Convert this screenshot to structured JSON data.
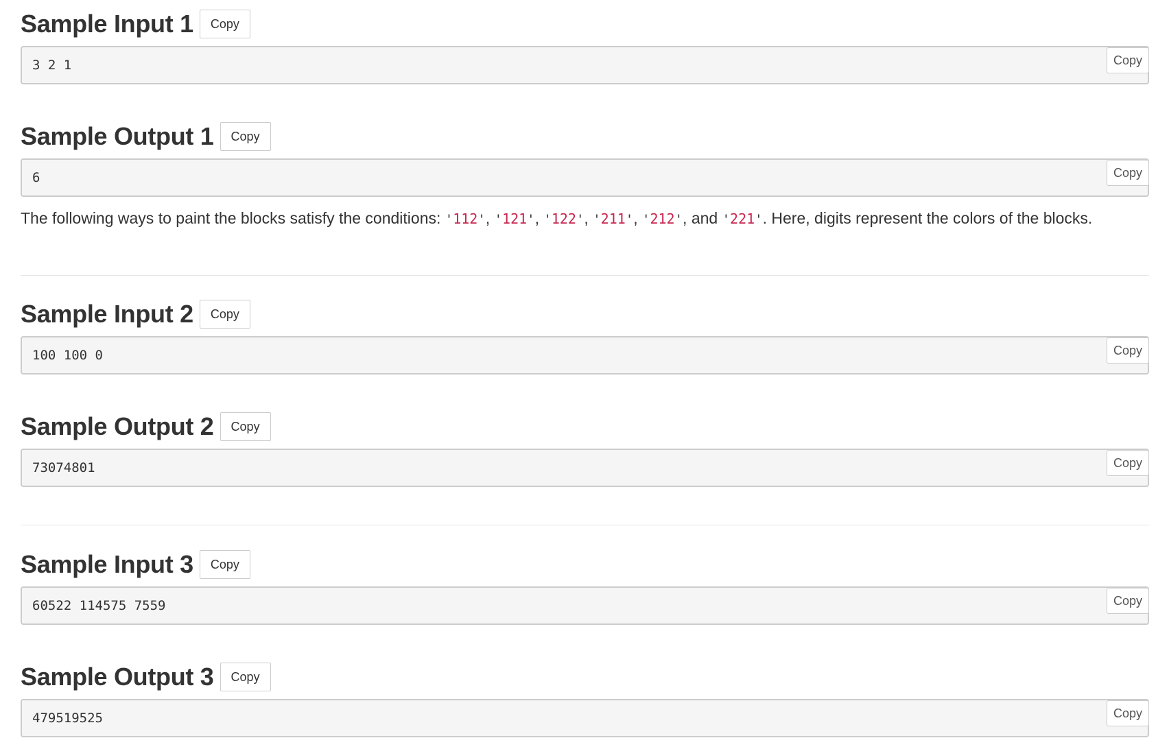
{
  "copy_label": "Copy",
  "samples": [
    {
      "title": "Sample Input 1",
      "value": "3 2 1"
    },
    {
      "title": "Sample Output 1",
      "value": "6"
    },
    {
      "title": "Sample Input 2",
      "value": "100 100 0"
    },
    {
      "title": "Sample Output 2",
      "value": "73074801"
    },
    {
      "title": "Sample Input 3",
      "value": "60522 114575 7559"
    },
    {
      "title": "Sample Output 3",
      "value": "479519525"
    }
  ],
  "note": {
    "prefix": "The following ways to paint the blocks satisfy the conditions: ",
    "codes": [
      "112",
      "121",
      "122",
      "211",
      "212",
      "221"
    ],
    "sep": ", ",
    "and": ", and ",
    "suffix": ". Here, digits represent the colors of the blocks."
  },
  "colors": {
    "code_text": "#c7254e",
    "pre_background": "#f5f5f5"
  }
}
